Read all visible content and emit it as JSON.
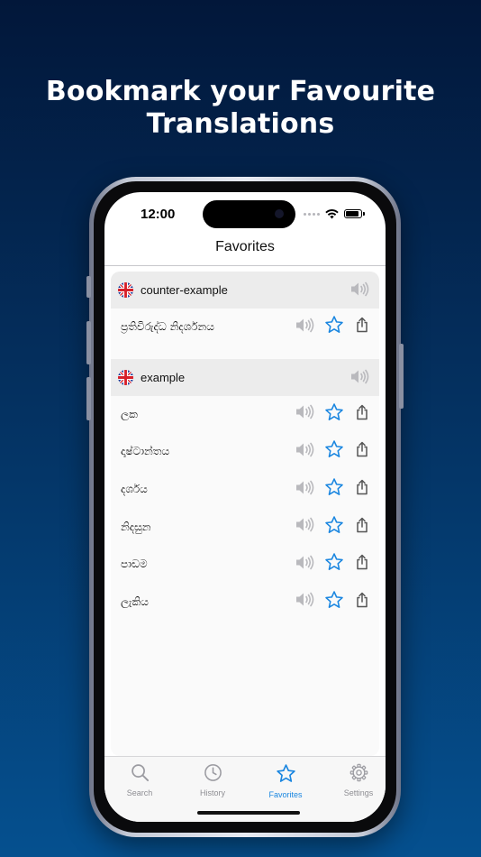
{
  "headline": {
    "line1": "Bookmark your Favourite",
    "line2": "Translations"
  },
  "status_bar": {
    "time": "12:00"
  },
  "nav": {
    "title": "Favorites"
  },
  "groups": [
    {
      "word": "counter-example",
      "language_flag": "uk-flag-icon",
      "translations": [
        "ප්‍රතිවිරුද්ධ නිදර්ශනය"
      ]
    },
    {
      "word": "example",
      "language_flag": "uk-flag-icon",
      "translations": [
        "ලක",
        "දෘෂ්ටාන්තය",
        "දර්ශය",
        "නිදසුන",
        "පාඩම",
        "ලැකිය"
      ]
    }
  ],
  "icons": {
    "speaker": "speaker-icon",
    "star": "star-icon",
    "share": "share-icon"
  },
  "tabs": [
    {
      "label": "Search",
      "icon": "search-icon",
      "active": false
    },
    {
      "label": "History",
      "icon": "clock-icon",
      "active": false
    },
    {
      "label": "Favorites",
      "icon": "star-icon",
      "active": true
    },
    {
      "label": "Settings",
      "icon": "gear-icon",
      "active": false
    }
  ],
  "colors": {
    "accent": "#1a86e0",
    "inactive": "#8e8e93",
    "header_bg": "#ececec"
  }
}
